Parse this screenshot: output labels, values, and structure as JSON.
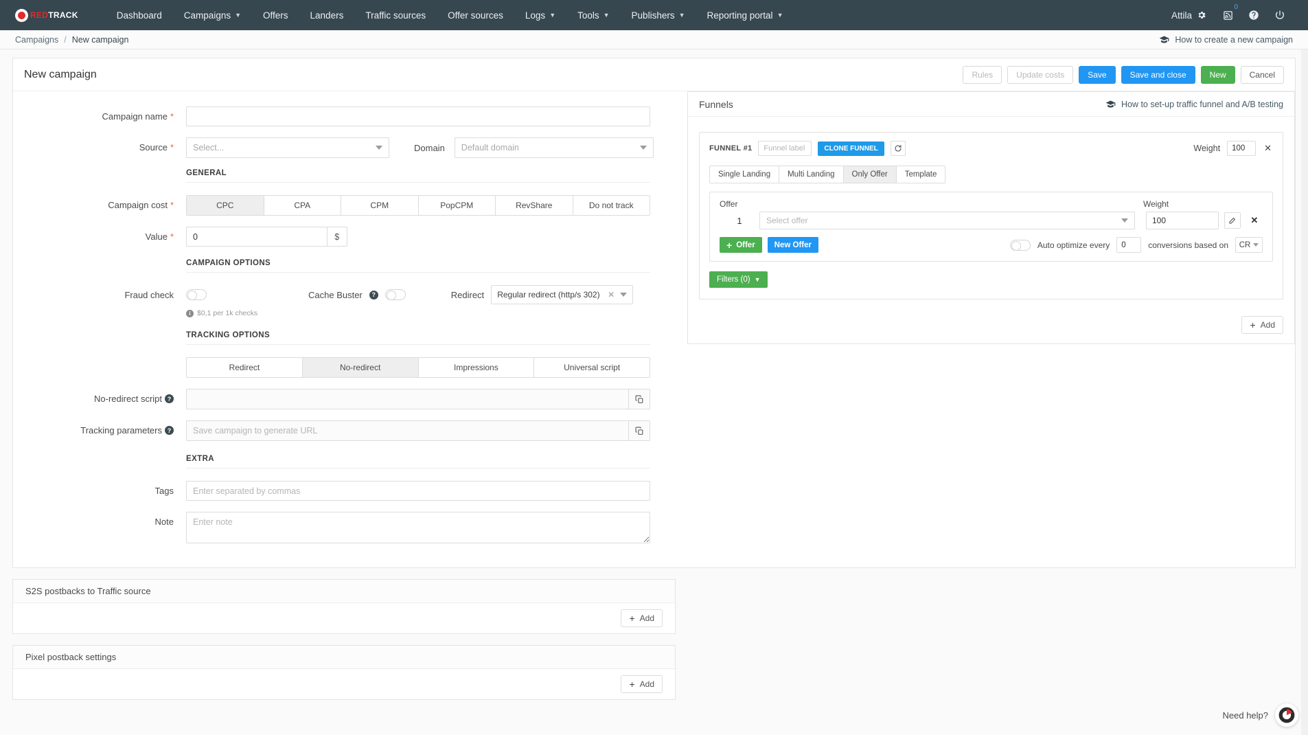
{
  "navbar": {
    "logo": {
      "red": "RED",
      "white": "TRACK"
    },
    "items": [
      {
        "label": "Dashboard",
        "has_caret": false
      },
      {
        "label": "Campaigns",
        "has_caret": true
      },
      {
        "label": "Offers",
        "has_caret": false
      },
      {
        "label": "Landers",
        "has_caret": false
      },
      {
        "label": "Traffic sources",
        "has_caret": false
      },
      {
        "label": "Offer sources",
        "has_caret": false
      },
      {
        "label": "Logs",
        "has_caret": true
      },
      {
        "label": "Tools",
        "has_caret": true
      },
      {
        "label": "Publishers",
        "has_caret": true
      },
      {
        "label": "Reporting portal",
        "has_caret": true
      }
    ],
    "user": "Attila",
    "notification_count": "0"
  },
  "breadcrumb": {
    "parent": "Campaigns",
    "separator": "/",
    "current": "New campaign",
    "help_link": "How to create a new campaign"
  },
  "page": {
    "title": "New campaign",
    "actions": {
      "rules": "Rules",
      "update_costs": "Update costs",
      "save": "Save",
      "save_and_close": "Save and close",
      "new": "New",
      "cancel": "Cancel"
    }
  },
  "form": {
    "campaign_name": {
      "label": "Campaign name",
      "required": true,
      "value": "",
      "placeholder": ""
    },
    "source": {
      "label": "Source",
      "required": true,
      "value": "Select..."
    },
    "domain": {
      "label": "Domain",
      "required": false,
      "value": "Default domain"
    },
    "section_general": "GENERAL",
    "campaign_cost": {
      "label": "Campaign cost",
      "required": true,
      "options": [
        "CPC",
        "CPA",
        "CPM",
        "PopCPM",
        "RevShare",
        "Do not track"
      ],
      "selected": "CPC"
    },
    "value": {
      "label": "Value",
      "required": true,
      "value": "0",
      "suffix": "$"
    },
    "section_campaign_options": "CAMPAIGN OPTIONS",
    "fraud_check": {
      "label": "Fraud check",
      "enabled": false,
      "hint": "$0,1 per 1k checks"
    },
    "cache_buster": {
      "label": "Cache Buster",
      "enabled": false
    },
    "redirect": {
      "label": "Redirect",
      "value": "Regular redirect (http/s 302)"
    },
    "section_tracking_options": "TRACKING OPTIONS",
    "tracking_mode": {
      "options": [
        "Redirect",
        "No-redirect",
        "Impressions",
        "Universal script"
      ],
      "selected": "No-redirect"
    },
    "no_redirect_script": {
      "label": "No-redirect script",
      "value": "",
      "placeholder": ""
    },
    "tracking_parameters": {
      "label": "Tracking parameters",
      "value": "",
      "placeholder": "Save campaign to generate URL"
    },
    "section_extra": "EXTRA",
    "tags": {
      "label": "Tags",
      "value": "",
      "placeholder": "Enter separated by commas"
    },
    "note": {
      "label": "Note",
      "value": "",
      "placeholder": "Enter note"
    }
  },
  "panels": [
    {
      "title": "S2S postbacks to Traffic source",
      "add_label": "Add"
    },
    {
      "title": "Pixel postback settings",
      "add_label": "Add"
    }
  ],
  "funnels": {
    "title": "Funnels",
    "help_link": "How to set-up traffic funnel and A/B testing",
    "add_label": "Add",
    "funnel": {
      "number_label": "FUNNEL #1",
      "label_placeholder": "Funnel label",
      "label_value": "",
      "clone_label": "CLONE FUNNEL",
      "weight_label": "Weight",
      "weight_value": "100",
      "close_label": "✕",
      "tabs": {
        "options": [
          "Single Landing",
          "Multi Landing",
          "Only Offer",
          "Template"
        ],
        "selected": "Only Offer"
      },
      "offer_col_label": "Offer",
      "weight_col_label": "Weight",
      "offers": [
        {
          "index": "1",
          "select_placeholder": "Select offer",
          "weight": "100"
        }
      ],
      "add_offer_label": "Offer",
      "new_offer_label": "New Offer",
      "auto_optimize": {
        "enabled": false,
        "text_before": "Auto optimize every",
        "count": "0",
        "text_after": "conversions based on",
        "metric": "CR"
      },
      "filters_label": "Filters (0)"
    }
  },
  "need_help": {
    "text": "Need help?"
  },
  "colors": {
    "navbar_bg": "#37474f",
    "primary_blue": "#2196f3",
    "green": "#4caf50",
    "required_star": "#f0642a",
    "brand_red": "#e22b2b"
  }
}
